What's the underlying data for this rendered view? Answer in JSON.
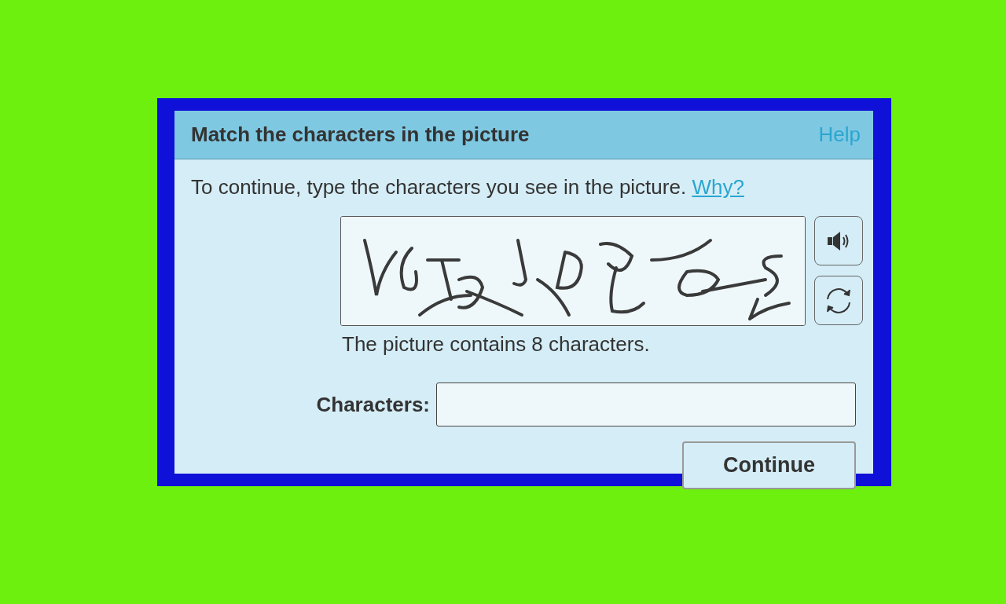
{
  "dialog": {
    "title": "Match the characters in the picture",
    "help_link": "Help"
  },
  "instruction": {
    "text": "To continue, type the characters you see in the picture.",
    "why_link": "Why?"
  },
  "captcha": {
    "kind": "picture"
  },
  "captcha_buttons": [
    {
      "kind": "audio"
    },
    {
      "kind": "refresh"
    }
  ],
  "caption": "The picture contains 8 characters.",
  "field": {
    "label": "Characters:"
  },
  "buttons": [
    "Continue"
  ]
}
